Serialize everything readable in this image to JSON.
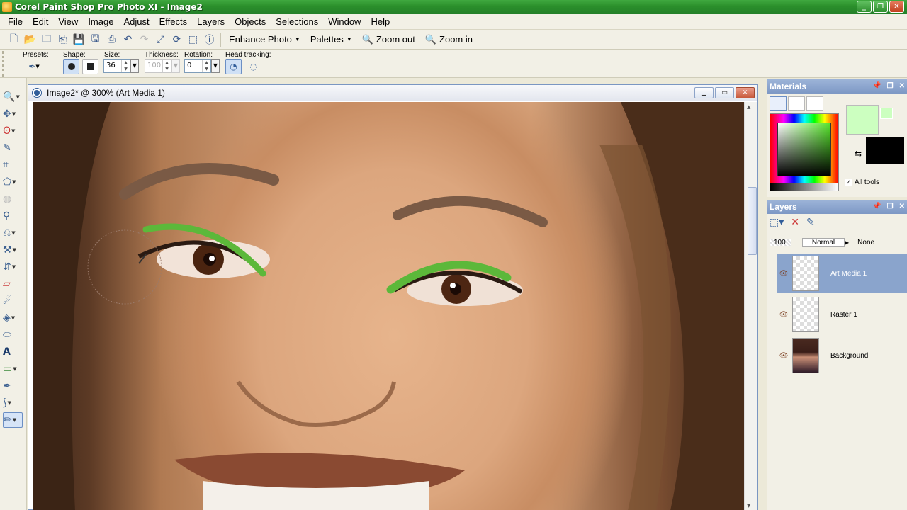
{
  "window": {
    "title": "Corel Paint Shop Pro Photo XI - Image2"
  },
  "menu": [
    "File",
    "Edit",
    "View",
    "Image",
    "Adjust",
    "Effects",
    "Layers",
    "Objects",
    "Selections",
    "Window",
    "Help"
  ],
  "toolbar": {
    "enhance": "Enhance Photo",
    "palettes": "Palettes",
    "zoom_out": "Zoom out",
    "zoom_in": "Zoom in"
  },
  "options": {
    "presets_label": "Presets:",
    "shape_label": "Shape:",
    "size_label": "Size:",
    "size_value": "36",
    "thickness_label": "Thickness:",
    "thickness_value": "100",
    "rotation_label": "Rotation:",
    "rotation_value": "0",
    "head_label": "Head tracking:"
  },
  "document": {
    "title": "Image2* @ 300% (Art Media 1)"
  },
  "materials": {
    "title": "Materials",
    "all_tools": "All tools",
    "fg_color": "#ccffc0",
    "bg_color": "#000000"
  },
  "layers": {
    "title": "Layers",
    "opacity": "100",
    "blend": "Normal",
    "mask": "None",
    "items": [
      {
        "name": "Art Media 1"
      },
      {
        "name": "Raster 1"
      },
      {
        "name": "Background"
      }
    ]
  }
}
